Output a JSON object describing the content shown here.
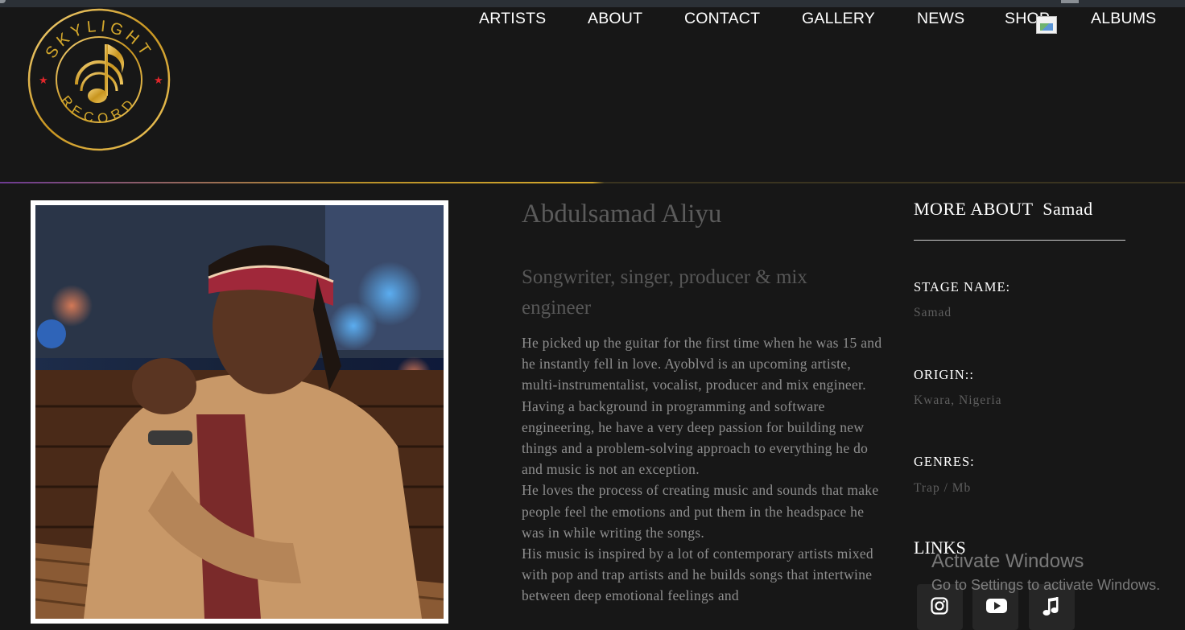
{
  "logo": {
    "top_text": "SKYLIGHT",
    "bottom_text": "RECORD",
    "color": "#d4a82c"
  },
  "nav": [
    "ARTISTS",
    "ABOUT",
    "CONTACT",
    "GALLERY",
    "NEWS",
    "SHOP",
    "ALBUMS"
  ],
  "artist": {
    "name": "Abdulsamad Aliyu",
    "role": "Songwriter, singer, producer & mix engineer",
    "bio": [
      "He picked up the guitar for the first time when he was 15 and he instantly fell in love. Ayoblvd is an upcoming artiste, multi-instrumentalist, vocalist, producer and mix engineer.",
      "Having a background in programming and software engineering, he have a very deep passion for building new things and a problem-solving approach to everything he do and music is not an exception.",
      "He loves the process of creating music and sounds that make people feel the emotions and put them in the headspace he was in while writing the songs.",
      "His music is inspired by a lot of contemporary artists mixed with pop and trap artists and he builds songs that intertwine between deep emotional feelings and"
    ]
  },
  "sidebar": {
    "heading": "MORE ABOUT  Samad",
    "stage_name_label": "STAGE NAME:",
    "stage_name": "Samad",
    "origin_label": "ORIGIN::",
    "origin": "Kwara, Nigeria",
    "genres_label": "GENRES:",
    "genres": "Trap / Mb",
    "links_heading": "LINKS",
    "social_icons": [
      "instagram-icon",
      "youtube-icon",
      "music-note-icon"
    ]
  },
  "watermark": {
    "title": "Activate Windows",
    "subtitle": "Go to Settings to activate Windows."
  }
}
